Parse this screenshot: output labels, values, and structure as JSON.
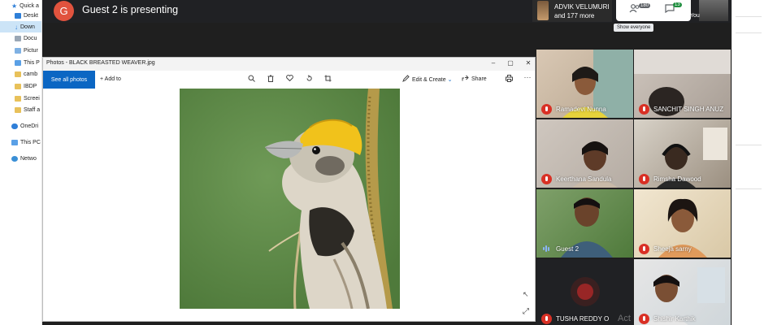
{
  "explorer": {
    "items": [
      {
        "label": "Quick a",
        "icon": "star-icon"
      },
      {
        "label": "Deskt",
        "icon": "folder-icon"
      },
      {
        "label": "Down",
        "icon": "download-icon",
        "selected": true
      },
      {
        "label": "Docu",
        "icon": "folder-icon"
      },
      {
        "label": "Pictur",
        "icon": "folder-icon"
      },
      {
        "label": "This P",
        "icon": "pc-icon"
      },
      {
        "label": "camb",
        "icon": "folder-icon"
      },
      {
        "label": "IBDP",
        "icon": "folder-icon"
      },
      {
        "label": "Screei",
        "icon": "folder-icon"
      },
      {
        "label": "Staff a",
        "icon": "folder-icon"
      },
      {
        "label": "OneDri",
        "icon": "cloud-icon"
      },
      {
        "label": "This PC",
        "icon": "pc-icon"
      },
      {
        "label": "Netwo",
        "icon": "network-icon"
      }
    ]
  },
  "meet": {
    "presenter_initial": "G",
    "presenting_text": "Guest 2 is presenting",
    "presenter_tile_line1": "ADVIK VELUMURI",
    "presenter_tile_line2": "and 177 more",
    "people_count": "180",
    "chat_count": "13",
    "you_label": "You",
    "tooltip": "Show everyone",
    "watermark": "Act"
  },
  "photos": {
    "title": "Photos - BLACK BREASTED WEAVER.jpg",
    "see_all_label": "See all photos",
    "add_to_label": "+ Add to",
    "edit_create_label": "Edit & Create",
    "share_label": "Share"
  },
  "participants": [
    {
      "name": "Ramadevi Nunna",
      "muted": true
    },
    {
      "name": "SANCHIT SINGH ANUZ",
      "muted": true
    },
    {
      "name": "Keerthana Sandula",
      "muted": true
    },
    {
      "name": "Rimsha Dawood",
      "muted": true
    },
    {
      "name": "Guest 2",
      "muted": false
    },
    {
      "name": "Sheeja sarny",
      "muted": true
    },
    {
      "name": "TUSHA REDDY O",
      "muted": true
    },
    {
      "name": "Shishir Karthik",
      "muted": true
    }
  ],
  "colors": {
    "meet_bar": "#202124",
    "accent_blue": "#0b66c3",
    "mute_red": "#d93025",
    "avatar_orange": "#e1533e"
  }
}
